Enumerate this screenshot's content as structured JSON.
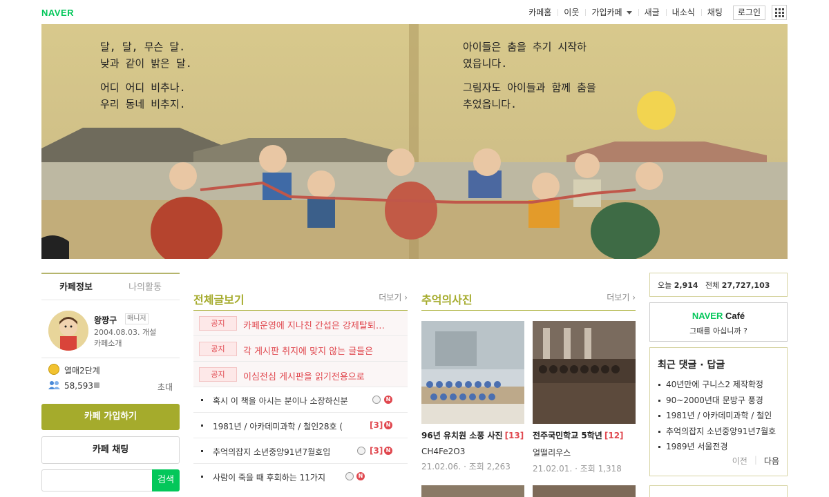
{
  "topbar": {
    "logo": "NAVER",
    "nav": [
      "카페홈",
      "이웃",
      "가입카페",
      "새글",
      "내소식",
      "채팅"
    ],
    "login": "로그인"
  },
  "colors": {
    "accent": "#a5ab2c",
    "naver_green": "#03c75a",
    "notice_red": "#e0484f"
  },
  "left": {
    "tabs": [
      "카페정보",
      "나의활동"
    ],
    "manager": {
      "name": "왕짱구",
      "badge": "매니저",
      "date": "2004.08.03. 개설",
      "intro": "카페소개"
    },
    "level": "열매2단계",
    "members": "58,593",
    "invite": "초대",
    "join_button": "카페 가입하기",
    "chat_button": "카페 채팅",
    "search_button": "검색"
  },
  "all_posts": {
    "title": "전체글보기",
    "more": "더보기",
    "notices": [
      {
        "badge": "공지",
        "text": "카페운영에 지나친 간섭은 강제탈퇴합니다"
      },
      {
        "badge": "공지",
        "text": "각 게시판 취지에 맞지 않는 글들은"
      },
      {
        "badge": "공지",
        "text": "이심전심 게시판을 읽기전용으로"
      }
    ],
    "posts": [
      {
        "text": "혹시 이 책을 아시는 분이나 소장하신분",
        "count": ""
      },
      {
        "text": "1981년 / 아카데미과학 / 철인28호 (",
        "count": "[3]"
      },
      {
        "text": "추억의잡지 소년중앙91년7월호입",
        "count": "[3]"
      },
      {
        "text": "사람이 죽을 때 후회하는 11가지",
        "count": ""
      }
    ]
  },
  "photos": {
    "title": "추억의사진",
    "more": "더보기",
    "items": [
      {
        "title": "96년 유치원 소풍 사진",
        "count": "[13]",
        "author": "CH4Fe2O3",
        "meta": "21.02.06. · 조회 2,263"
      },
      {
        "title": "전주국민학교 5학년",
        "count": "[12]",
        "author": "얼떨리우스",
        "meta": "21.02.01. · 조회 1,318"
      }
    ]
  },
  "right": {
    "visit": {
      "today_label": "오늘",
      "today": "2,914",
      "total_label": "전체",
      "total": "27,727,103"
    },
    "naver_cafe": {
      "brand": "NAVER",
      "cafe": "Café",
      "sub": "그때를 아십니까 ?"
    },
    "recent": {
      "title": "최근 댓글 · 답글",
      "items": [
        "40년만에 구니스2 제작확정",
        "90~2000년대 문방구 풍경",
        "1981년 / 아카데미과학 / 철인",
        "추억의잡지 소년중앙91년7월호",
        "1989년 서울전경"
      ],
      "prev": "이전",
      "next": "다음"
    }
  },
  "banner": {
    "text_left": [
      "달, 달, 무슨 달.",
      "낮과 같이 밝은 달.",
      "어디 어디 비추나.",
      "우리 동네 비추지."
    ],
    "text_right": [
      "아이들은 춤을 추기 시작하",
      "였읍니다.",
      "그림자도 아이들과 함께 춤을",
      "추었읍니다."
    ]
  }
}
